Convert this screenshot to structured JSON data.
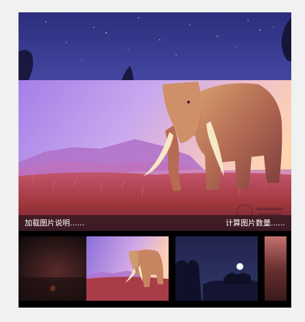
{
  "gallery": {
    "caption_left": "加载图片说明......",
    "caption_right": "计算图片数量......",
    "thumbnails": [
      {
        "name": "thumbnail-dark-sunset"
      },
      {
        "name": "thumbnail-elephant",
        "active": true
      },
      {
        "name": "thumbnail-night-jungle"
      },
      {
        "name": "thumbnail-partial"
      }
    ]
  },
  "colors": {
    "page_background": "#f1f1f1",
    "frame_background": "#000000",
    "night_sky": "#3a3f8f",
    "caption_bar": "#28161e"
  }
}
